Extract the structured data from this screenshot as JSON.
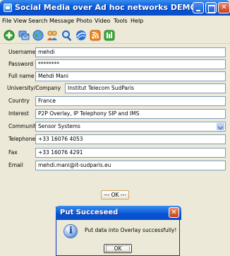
{
  "window": {
    "title": "Social Media over Ad hoc networks DEMO",
    "min_glyph": "",
    "max_glyph": "",
    "close_glyph": "✕"
  },
  "menu": [
    "File",
    "View",
    "Search",
    "Message",
    "Photo",
    "Video",
    "Tools",
    "Help"
  ],
  "toolbar_icons": [
    "add-icon",
    "messages-icon",
    "globe-icon",
    "community-icon",
    "search-icon",
    "network-icon",
    "rss-icon",
    "data-icon"
  ],
  "form": {
    "username": {
      "label": "Username",
      "value": "mehdi"
    },
    "password": {
      "label": "Password",
      "value": "********"
    },
    "fullname": {
      "label": "Full name",
      "value": "Mehdi Mani"
    },
    "university": {
      "label": "University/Company",
      "value": "Institut Telecom SudParis"
    },
    "country": {
      "label": "Country",
      "value": "France"
    },
    "interest": {
      "label": "Interest",
      "value": "P2P Overlay, IP Telephony SIP and IMS"
    },
    "community": {
      "label": "Community",
      "value": "Sensor Systems"
    },
    "telephone": {
      "label": "Telephone",
      "value": "+33 16076 4053"
    },
    "fax": {
      "label": "Fax",
      "value": "+33 16076 4291"
    },
    "email": {
      "label": "Email",
      "value": "mehdi.mani@it-sudparis.eu"
    },
    "ok_label": "--- OK ---"
  },
  "dialog": {
    "title": "Put Succeseed",
    "close_glyph": "✕",
    "message": "Put data into Overlay successfully!",
    "ok_label": "OK",
    "icon_glyph": "i"
  },
  "colors": {
    "titlebar": "#0553d6",
    "window_bg": "#ece9d8",
    "close_button": "#c5401f"
  }
}
